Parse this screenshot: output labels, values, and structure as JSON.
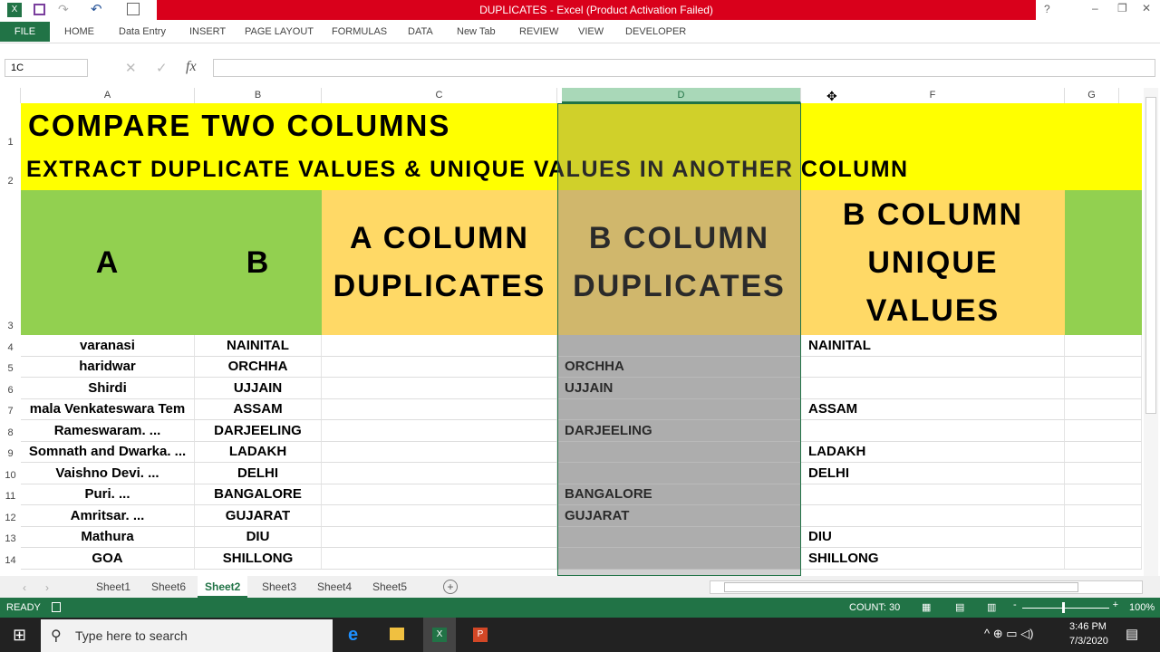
{
  "window": {
    "title": "DUPLICATES -  Excel (Product Activation Failed)"
  },
  "ribbon": {
    "tabs": [
      "FILE",
      "HOME",
      "Data Entry",
      "INSERT",
      "PAGE LAYOUT",
      "FORMULAS",
      "DATA",
      "New Tab",
      "REVIEW",
      "VIEW",
      "DEVELOPER"
    ]
  },
  "formula_bar": {
    "name_box": "1C",
    "fx": "fx",
    "value": ""
  },
  "columns": [
    "A",
    "B",
    "C",
    "D",
    "F",
    "G"
  ],
  "rows": [
    "1",
    "2",
    "3",
    "4",
    "5",
    "6",
    "7",
    "8",
    "9",
    "10",
    "11",
    "12",
    "13",
    "14"
  ],
  "sheet": {
    "title1": "COMPARE TWO COLUMNS",
    "title2": "EXTRACT DUPLICATE VALUES & UNIQUE VALUES IN ANOTHER COLUMN",
    "headers": {
      "a": "A",
      "b": "B",
      "c": "A COLUMN DUPLICATES",
      "d": "B COLUMN DUPLICATES",
      "f": "B COLUMN UNIQUE VALUES"
    },
    "data": [
      {
        "a": "varanasi",
        "b": "NAINITAL",
        "d": "",
        "f": "NAINITAL"
      },
      {
        "a": "haridwar",
        "b": "ORCHHA",
        "d": "ORCHHA",
        "f": ""
      },
      {
        "a": "Shirdi",
        "b": "UJJAIN",
        "d": "UJJAIN",
        "f": ""
      },
      {
        "a": "mala Venkateswara Tem",
        "b": "ASSAM",
        "d": "",
        "f": "ASSAM"
      },
      {
        "a": "Rameswaram. ...",
        "b": "DARJEELING",
        "d": "DARJEELING",
        "f": ""
      },
      {
        "a": "Somnath and Dwarka. ...",
        "b": "LADAKH",
        "d": "",
        "f": "LADAKH"
      },
      {
        "a": "Vaishno Devi. ...",
        "b": "DELHI",
        "d": "",
        "f": "DELHI"
      },
      {
        "a": "Puri. ...",
        "b": "BANGALORE",
        "d": "BANGALORE",
        "f": ""
      },
      {
        "a": "Amritsar. ...",
        "b": "GUJARAT",
        "d": "GUJARAT",
        "f": ""
      },
      {
        "a": "Mathura",
        "b": "DIU",
        "d": "",
        "f": "DIU"
      },
      {
        "a": "GOA",
        "b": "SHILLONG",
        "d": "",
        "f": "SHILLONG"
      }
    ]
  },
  "sheet_tabs": [
    "Sheet1",
    "Sheet6",
    "Sheet2",
    "Sheet3",
    "Sheet4",
    "Sheet5"
  ],
  "active_sheet": "Sheet2",
  "status": {
    "mode": "READY",
    "count": "COUNT: 30",
    "zoom": "100%"
  },
  "taskbar": {
    "search_placeholder": "Type here to search",
    "time": "3:46 PM",
    "date": "7/3/2020"
  },
  "colors": {
    "excel_green": "#217346",
    "title_red": "#d9001b",
    "yellow": "#ffff00",
    "green": "#92d050",
    "orange": "#ffd966"
  }
}
